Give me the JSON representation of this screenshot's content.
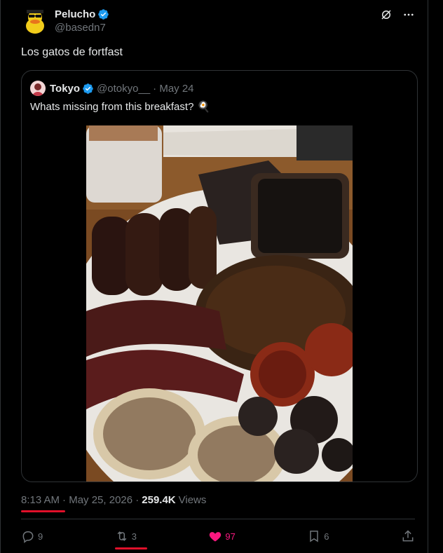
{
  "author": {
    "display_name": "Pelucho",
    "handle": "@basedn7",
    "avatar_icon": "duck-avatar-icon",
    "verified": true
  },
  "tweet_text": "Los gatos de fortfast",
  "quoted": {
    "display_name": "Tokyo",
    "handle": "@otokyo__",
    "date": "· May 24",
    "text": "Whats missing from this breakfast?",
    "emoji": "🍳",
    "media_icon": "burnt-breakfast-photo"
  },
  "meta": {
    "time": "8:13 AM",
    "date": "· May 25, 2026 ·",
    "views_count": "259.4K",
    "views_label": "Views"
  },
  "actions": {
    "replies": "9",
    "reposts": "3",
    "likes": "97",
    "bookmarks": "6"
  },
  "colors": {
    "accent_blue": "#1d9bf0",
    "like_pink": "#f91880",
    "highlight_red": "#e0102a",
    "muted": "#71767b"
  }
}
